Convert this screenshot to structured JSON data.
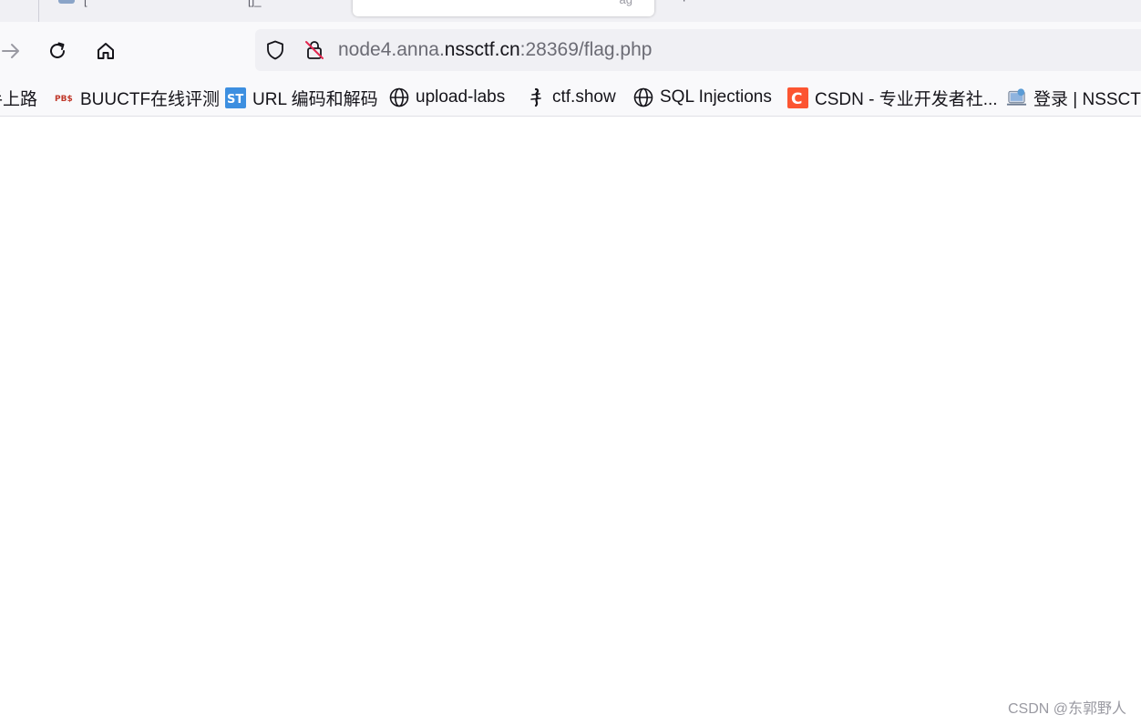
{
  "browser": {
    "tabs": {
      "inactive_tab_fragment_a": "[",
      "inactive_tab_fragment_b": "[]_",
      "active_tab_fragment": "ag"
    },
    "address_bar": {
      "url_prefix": "node4.anna.",
      "url_domain": "nssctf.cn",
      "url_suffix": ":28369/flag.php"
    },
    "bookmarks": [
      {
        "label": "手上路",
        "icon": "cut-off-favicon"
      },
      {
        "label": "BUUCTF在线评测",
        "icon": "buuctf-icon"
      },
      {
        "label": "URL 编码和解码",
        "icon": "st-icon"
      },
      {
        "label": "upload-labs",
        "icon": "globe-icon"
      },
      {
        "label": "ctf.show",
        "icon": "ctfshow-icon"
      },
      {
        "label": "SQL Injections",
        "icon": "globe-icon"
      },
      {
        "label": "CSDN - 专业开发者社...",
        "icon": "csdn-icon"
      },
      {
        "label": "登录 | NSSCTF",
        "icon": "nssctf-icon"
      }
    ]
  },
  "watermark": "CSDN @东郭野人",
  "colors": {
    "csdn_red": "#fc5531",
    "st_blue": "#3d8fe0",
    "disabled_gray": "#9a9aa3"
  }
}
